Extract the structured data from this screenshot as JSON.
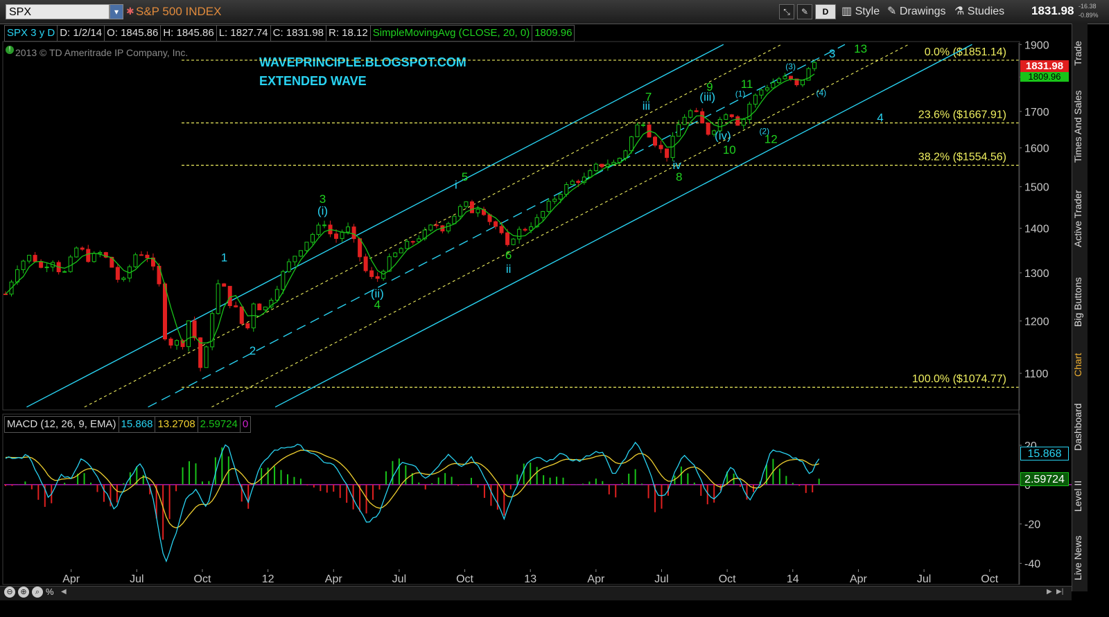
{
  "toolbar": {
    "symbol": "SPX",
    "index_name": "S&P 500 INDEX",
    "style_label": "Style",
    "drawings_label": "Drawings",
    "studies_label": "Studies",
    "period_label": "D",
    "last_price": "1831.98",
    "change": "-16.38",
    "change_pct": "-0.89%"
  },
  "header": {
    "symbol_period": "SPX 3 y D",
    "date": "D: 1/2/14",
    "open": "O: 1845.86",
    "high": "H: 1845.86",
    "low": "L: 1827.74",
    "close": "C: 1831.98",
    "range": "R: 18.12",
    "study_name": "SimpleMovingAvg (CLOSE, 20, 0)",
    "study_value": "1809.96",
    "copyright": "2013 © TD Ameritrade IP Company, Inc."
  },
  "annotations": {
    "blog": "WAVEPRINCIPLE.BLOGSPOT.COM",
    "subtitle": "EXTENDED WAVE"
  },
  "macd_header": {
    "name": "MACD (12, 26, 9, EMA)",
    "value": "15.868",
    "avg": "13.2708",
    "diff": "2.59724",
    "zero": "0"
  },
  "sidebar_tabs": [
    "Trade",
    "Times And Sales",
    "Active Trader",
    "Big Buttons",
    "Chart",
    "Dashboard",
    "Level II",
    "Live News"
  ],
  "colors": {
    "accent_cyan": "#29d3f2",
    "fib_yellow": "#f0f060",
    "label_green": "#1fd21f",
    "up_candle": "#19c419",
    "down_candle": "#e02020",
    "price_tag": "#e01e1e",
    "sma": "#19c419",
    "macd_line": "#29d3f2",
    "signal_line": "#f0d030",
    "zero_line": "#d020d0"
  },
  "chart_data": [
    {
      "type": "candlestick",
      "x_tick_labels": [
        "Apr",
        "Jul",
        "Oct",
        "12",
        "Apr",
        "Jul",
        "Oct",
        "13",
        "Apr",
        "Jul",
        "Oct",
        "14",
        "Apr",
        "Jul",
        "Oct"
      ],
      "y_ticks": [
        1100,
        1200,
        1300,
        1400,
        1500,
        1600,
        1700,
        1800,
        1900
      ],
      "y_tick_labels": [
        "1100",
        "1200",
        "1300",
        "1400",
        "1500",
        "1600",
        "1700",
        "1800",
        "1900"
      ],
      "ylim": [
        1035,
        1905
      ],
      "log_scale": true,
      "price_tags": {
        "last": "1831.98",
        "sma": "1809.96"
      },
      "fib_levels": [
        {
          "label": "0.0%  ($1851.14)",
          "value": 1851.14
        },
        {
          "label": "23.6%  ($1667.91)",
          "value": 1667.91
        },
        {
          "label": "38.2%  ($1554.56)",
          "value": 1554.56
        },
        {
          "label": "100.0%  ($1074.77)",
          "value": 1074.77
        }
      ],
      "price_path_months": [
        {
          "m": 0.0,
          "p": 1255
        },
        {
          "m": 0.6,
          "p": 1320
        },
        {
          "m": 1.2,
          "p": 1340
        },
        {
          "m": 1.6,
          "p": 1310
        },
        {
          "m": 2.2,
          "p": 1330
        },
        {
          "m": 2.6,
          "p": 1290
        },
        {
          "m": 3.3,
          "p": 1360
        },
        {
          "m": 3.8,
          "p": 1330
        },
        {
          "m": 4.4,
          "p": 1345
        },
        {
          "m": 4.9,
          "p": 1310
        },
        {
          "m": 5.3,
          "p": 1270
        },
        {
          "m": 5.9,
          "p": 1340
        },
        {
          "m": 6.4,
          "p": 1345
        },
        {
          "m": 7.0,
          "p": 1280
        },
        {
          "m": 7.4,
          "p": 1130
        },
        {
          "m": 7.7,
          "p": 1180
        },
        {
          "m": 8.0,
          "p": 1130
        },
        {
          "m": 8.3,
          "p": 1210
        },
        {
          "m": 8.7,
          "p": 1160
        },
        {
          "m": 9.0,
          "p": 1090
        },
        {
          "m": 9.4,
          "p": 1210
        },
        {
          "m": 9.8,
          "p": 1290
        },
        {
          "m": 10.2,
          "p": 1240
        },
        {
          "m": 10.6,
          "p": 1220
        },
        {
          "m": 11.0,
          "p": 1170
        },
        {
          "m": 11.3,
          "p": 1240
        },
        {
          "m": 11.8,
          "p": 1220
        },
        {
          "m": 12.3,
          "p": 1260
        },
        {
          "m": 12.8,
          "p": 1310
        },
        {
          "m": 13.4,
          "p": 1350
        },
        {
          "m": 14.1,
          "p": 1390
        },
        {
          "m": 14.6,
          "p": 1415
        },
        {
          "m": 15.0,
          "p": 1370
        },
        {
          "m": 15.6,
          "p": 1405
        },
        {
          "m": 16.0,
          "p": 1360
        },
        {
          "m": 16.5,
          "p": 1300
        },
        {
          "m": 16.9,
          "p": 1280
        },
        {
          "m": 17.4,
          "p": 1320
        },
        {
          "m": 18.0,
          "p": 1350
        },
        {
          "m": 18.6,
          "p": 1370
        },
        {
          "m": 19.2,
          "p": 1390
        },
        {
          "m": 19.6,
          "p": 1410
        },
        {
          "m": 20.0,
          "p": 1400
        },
        {
          "m": 20.5,
          "p": 1430
        },
        {
          "m": 21.0,
          "p": 1460
        },
        {
          "m": 21.3,
          "p": 1440
        },
        {
          "m": 21.7,
          "p": 1455
        },
        {
          "m": 22.1,
          "p": 1420
        },
        {
          "m": 22.6,
          "p": 1395
        },
        {
          "m": 22.9,
          "p": 1350
        },
        {
          "m": 23.3,
          "p": 1390
        },
        {
          "m": 23.8,
          "p": 1400
        },
        {
          "m": 24.3,
          "p": 1420
        },
        {
          "m": 24.9,
          "p": 1460
        },
        {
          "m": 25.5,
          "p": 1495
        },
        {
          "m": 26.0,
          "p": 1515
        },
        {
          "m": 26.5,
          "p": 1520
        },
        {
          "m": 27.0,
          "p": 1550
        },
        {
          "m": 27.5,
          "p": 1560
        },
        {
          "m": 27.9,
          "p": 1560
        },
        {
          "m": 28.3,
          "p": 1590
        },
        {
          "m": 28.8,
          "p": 1650
        },
        {
          "m": 29.1,
          "p": 1680
        },
        {
          "m": 29.5,
          "p": 1630
        },
        {
          "m": 29.9,
          "p": 1600
        },
        {
          "m": 30.2,
          "p": 1575
        },
        {
          "m": 30.5,
          "p": 1620
        },
        {
          "m": 30.9,
          "p": 1680
        },
        {
          "m": 31.3,
          "p": 1700
        },
        {
          "m": 31.6,
          "p": 1690
        },
        {
          "m": 32.1,
          "p": 1640
        },
        {
          "m": 32.5,
          "p": 1660
        },
        {
          "m": 32.9,
          "p": 1700
        },
        {
          "m": 33.3,
          "p": 1690
        },
        {
          "m": 33.6,
          "p": 1655
        },
        {
          "m": 34.0,
          "p": 1720
        },
        {
          "m": 34.5,
          "p": 1760
        },
        {
          "m": 35.0,
          "p": 1780
        },
        {
          "m": 35.5,
          "p": 1800
        },
        {
          "m": 35.9,
          "p": 1790
        },
        {
          "m": 36.2,
          "p": 1770
        },
        {
          "m": 36.6,
          "p": 1810
        },
        {
          "m": 37.0,
          "p": 1845
        },
        {
          "m": 37.2,
          "p": 1832
        }
      ],
      "wave_labels": [
        {
          "text": "1",
          "m": 10.0,
          "p": 1325,
          "color": "cyan"
        },
        {
          "text": "2",
          "m": 11.3,
          "p": 1135,
          "color": "cyan"
        },
        {
          "text": "3",
          "m": 14.5,
          "p": 1460,
          "color": "green"
        },
        {
          "text": "(i)",
          "m": 14.5,
          "p": 1432,
          "color": "cyan"
        },
        {
          "text": "(ii)",
          "m": 17.0,
          "p": 1248,
          "color": "cyan"
        },
        {
          "text": "4",
          "m": 17.0,
          "p": 1225,
          "color": "green"
        },
        {
          "text": "i",
          "m": 20.6,
          "p": 1495,
          "color": "cyan"
        },
        {
          "text": "5",
          "m": 21.0,
          "p": 1515,
          "color": "green"
        },
        {
          "text": "6",
          "m": 23.0,
          "p": 1330,
          "color": "green"
        },
        {
          "text": "ii",
          "m": 23.0,
          "p": 1300,
          "color": "cyan"
        },
        {
          "text": "7",
          "m": 29.4,
          "p": 1730,
          "color": "green"
        },
        {
          "text": "iii",
          "m": 29.3,
          "p": 1705,
          "color": "cyan"
        },
        {
          "text": "iv",
          "m": 30.7,
          "p": 1545,
          "color": "cyan"
        },
        {
          "text": "8",
          "m": 30.8,
          "p": 1515,
          "color": "green"
        },
        {
          "text": "9",
          "m": 32.2,
          "p": 1760,
          "color": "green"
        },
        {
          "text": "(iii)",
          "m": 32.1,
          "p": 1730,
          "color": "cyan"
        },
        {
          "text": "(iv)",
          "m": 32.8,
          "p": 1622,
          "color": "cyan"
        },
        {
          "text": "10",
          "m": 33.1,
          "p": 1585,
          "color": "green"
        },
        {
          "text": "11",
          "m": 33.9,
          "p": 1768,
          "color": "green"
        },
        {
          "text": "(1)",
          "m": 33.6,
          "p": 1742,
          "color": "cyan"
        },
        {
          "text": "(2)",
          "m": 34.7,
          "p": 1637,
          "color": "cyan"
        },
        {
          "text": "12",
          "m": 35.0,
          "p": 1613,
          "color": "green"
        },
        {
          "text": "(3)",
          "m": 35.9,
          "p": 1823,
          "color": "cyan"
        },
        {
          "text": "(4)",
          "m": 37.3,
          "p": 1745,
          "color": "cyan"
        },
        {
          "text": "3",
          "m": 37.8,
          "p": 1860,
          "color": "cyan"
        },
        {
          "text": "13",
          "m": 39.1,
          "p": 1875,
          "color": "green"
        },
        {
          "text": "4",
          "m": 40.0,
          "p": 1672,
          "color": "cyan"
        }
      ]
    },
    {
      "type": "macd",
      "y_tick_labels": [
        "20",
        "0",
        "-20",
        "-40"
      ],
      "y_ticks": [
        20,
        0,
        -20,
        -40
      ],
      "ylim": [
        -43,
        26
      ],
      "macd_path_months": [
        {
          "m": 0.0,
          "v": 14
        },
        {
          "m": 0.5,
          "v": 13
        },
        {
          "m": 1.0,
          "v": 15
        },
        {
          "m": 1.5,
          "v": 5
        },
        {
          "m": 2.0,
          "v": -8
        },
        {
          "m": 2.5,
          "v": 5
        },
        {
          "m": 3.0,
          "v": 3
        },
        {
          "m": 3.5,
          "v": 14
        },
        {
          "m": 4.0,
          "v": 8
        },
        {
          "m": 4.4,
          "v": 0
        },
        {
          "m": 5.0,
          "v": -13
        },
        {
          "m": 5.5,
          "v": 0
        },
        {
          "m": 6.2,
          "v": 12
        },
        {
          "m": 6.7,
          "v": -5
        },
        {
          "m": 7.3,
          "v": -40
        },
        {
          "m": 7.7,
          "v": -28
        },
        {
          "m": 8.2,
          "v": -8
        },
        {
          "m": 8.7,
          "v": -2
        },
        {
          "m": 9.2,
          "v": -12
        },
        {
          "m": 9.7,
          "v": 10
        },
        {
          "m": 10.1,
          "v": 22
        },
        {
          "m": 10.6,
          "v": 4
        },
        {
          "m": 11.1,
          "v": -9
        },
        {
          "m": 11.6,
          "v": 8
        },
        {
          "m": 12.2,
          "v": 17
        },
        {
          "m": 12.8,
          "v": 19
        },
        {
          "m": 13.4,
          "v": 20
        },
        {
          "m": 14.0,
          "v": 16
        },
        {
          "m": 14.5,
          "v": 12
        },
        {
          "m": 15.0,
          "v": 10
        },
        {
          "m": 15.5,
          "v": 2
        },
        {
          "m": 16.0,
          "v": -10
        },
        {
          "m": 16.6,
          "v": -20
        },
        {
          "m": 17.1,
          "v": -14
        },
        {
          "m": 17.6,
          "v": 2
        },
        {
          "m": 18.1,
          "v": 12
        },
        {
          "m": 18.7,
          "v": 10
        },
        {
          "m": 19.2,
          "v": 3
        },
        {
          "m": 19.8,
          "v": 10
        },
        {
          "m": 20.3,
          "v": 16
        },
        {
          "m": 20.8,
          "v": 8
        },
        {
          "m": 21.3,
          "v": 14
        },
        {
          "m": 21.8,
          "v": 6
        },
        {
          "m": 22.3,
          "v": -5
        },
        {
          "m": 22.8,
          "v": -17
        },
        {
          "m": 23.3,
          "v": -3
        },
        {
          "m": 23.8,
          "v": 10
        },
        {
          "m": 24.3,
          "v": 14
        },
        {
          "m": 24.8,
          "v": 11
        },
        {
          "m": 25.3,
          "v": 16
        },
        {
          "m": 25.8,
          "v": 13
        },
        {
          "m": 26.3,
          "v": 12
        },
        {
          "m": 26.8,
          "v": 16
        },
        {
          "m": 27.3,
          "v": 17
        },
        {
          "m": 27.8,
          "v": 4
        },
        {
          "m": 28.3,
          "v": 13
        },
        {
          "m": 28.8,
          "v": 22
        },
        {
          "m": 29.3,
          "v": 12
        },
        {
          "m": 29.8,
          "v": -5
        },
        {
          "m": 30.2,
          "v": -6
        },
        {
          "m": 30.6,
          "v": 6
        },
        {
          "m": 31.0,
          "v": 16
        },
        {
          "m": 31.5,
          "v": 10
        },
        {
          "m": 31.9,
          "v": 0
        },
        {
          "m": 32.3,
          "v": -8
        },
        {
          "m": 32.7,
          "v": -4
        },
        {
          "m": 33.1,
          "v": 10
        },
        {
          "m": 33.5,
          "v": 4
        },
        {
          "m": 34.0,
          "v": -8
        },
        {
          "m": 34.5,
          "v": 0
        },
        {
          "m": 35.0,
          "v": 18
        },
        {
          "m": 35.5,
          "v": 16
        },
        {
          "m": 36.0,
          "v": 14
        },
        {
          "m": 36.4,
          "v": 12
        },
        {
          "m": 36.8,
          "v": 4
        },
        {
          "m": 37.3,
          "v": 16
        }
      ]
    }
  ]
}
